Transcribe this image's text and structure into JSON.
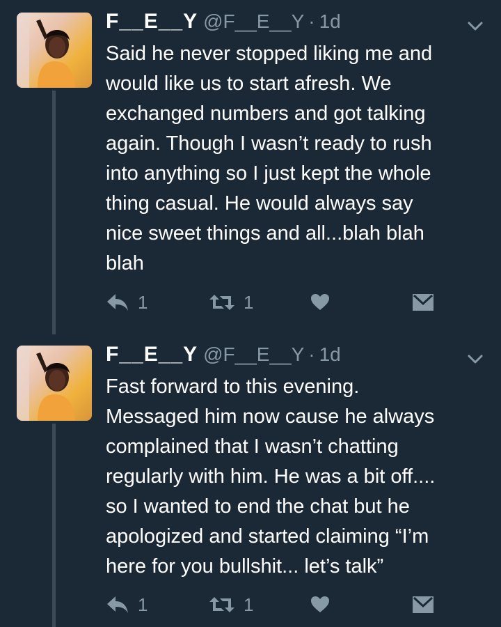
{
  "tweets": [
    {
      "display_name": "F__E__Y",
      "handle": "@F__E__Y",
      "separator": "·",
      "time": "1d",
      "lines": [
        "Said he never stopped liking me and",
        "would like us to start afresh. We",
        "exchanged numbers and got talking",
        "again. Though I wasn’t ready to rush",
        "into anything so I just kept the whole",
        "thing casual. He would always say",
        "nice sweet things and all...blah blah",
        "blah"
      ],
      "reply_count": "1",
      "retweet_count": "1"
    },
    {
      "display_name": "F__E__Y",
      "handle": "@F__E__Y",
      "separator": "·",
      "time": "1d",
      "lines": [
        "Fast forward to this evening.",
        "Messaged him now cause he always",
        "complained that I wasn’t chatting",
        "regularly with him. He was a bit off....",
        "so I wanted to end the chat but he",
        "apologized and started claiming “I’m",
        "here for you bullshit... let’s talk”"
      ],
      "reply_count": "1",
      "retweet_count": "1"
    }
  ],
  "icons": {
    "reply": "reply-icon",
    "retweet": "retweet-icon",
    "like": "heart-icon",
    "dm": "envelope-icon",
    "menu": "chevron-down-icon"
  },
  "colors": {
    "background": "#1b2836",
    "muted": "#8899a6",
    "thread_line": "#3c4a57"
  }
}
